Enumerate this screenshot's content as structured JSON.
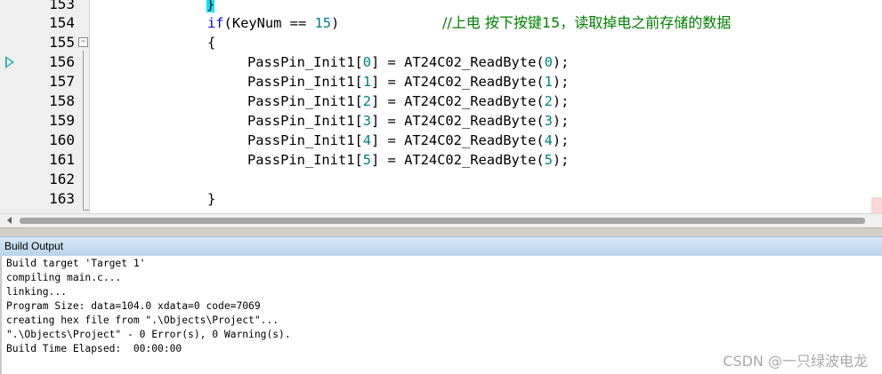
{
  "editor": {
    "lines": [
      {
        "num": "153",
        "code": "}"
      },
      {
        "num": "154",
        "kw": "if",
        "code": "(KeyNum == ",
        "num_lit": "15",
        "code_after": ")",
        "comment": "//上电 按下按键15，读取掉电之前存储的数据"
      },
      {
        "num": "155",
        "code": "{"
      },
      {
        "num": "156",
        "code": "PassPin_Init1[",
        "idx": "0",
        "mid": "] = AT24C02_ReadByte(",
        "arg": "0",
        "end": ");"
      },
      {
        "num": "157",
        "code": "PassPin_Init1[",
        "idx": "1",
        "mid": "] = AT24C02_ReadByte(",
        "arg": "1",
        "end": ");"
      },
      {
        "num": "158",
        "code": "PassPin_Init1[",
        "idx": "2",
        "mid": "] = AT24C02_ReadByte(",
        "arg": "2",
        "end": ");"
      },
      {
        "num": "159",
        "code": "PassPin_Init1[",
        "idx": "3",
        "mid": "] = AT24C02_ReadByte(",
        "arg": "3",
        "end": ");"
      },
      {
        "num": "160",
        "code": "PassPin_Init1[",
        "idx": "4",
        "mid": "] = AT24C02_ReadByte(",
        "arg": "4",
        "end": ");"
      },
      {
        "num": "161",
        "code": "PassPin_Init1[",
        "idx": "5",
        "mid": "] = AT24C02_ReadByte(",
        "arg": "5",
        "end": ");"
      },
      {
        "num": "162",
        "code": ""
      },
      {
        "num": "163",
        "code": "}"
      }
    ]
  },
  "build_output": {
    "title": "Build Output",
    "lines": [
      "Build target 'Target 1'",
      "compiling main.c...",
      "linking...",
      "Program Size: data=104.0 xdata=0 code=7069",
      "creating hex file from \".\\Objects\\Project\"...",
      "\".\\Objects\\Project\" - 0 Error(s), 0 Warning(s).",
      "Build Time Elapsed:  00:00:00"
    ]
  },
  "watermark": "CSDN @一只绿波电龙",
  "colors": {
    "keyword": "#0000ff",
    "number": "#008080",
    "comment": "#008000",
    "brace_highlight": "#00e5ff"
  }
}
